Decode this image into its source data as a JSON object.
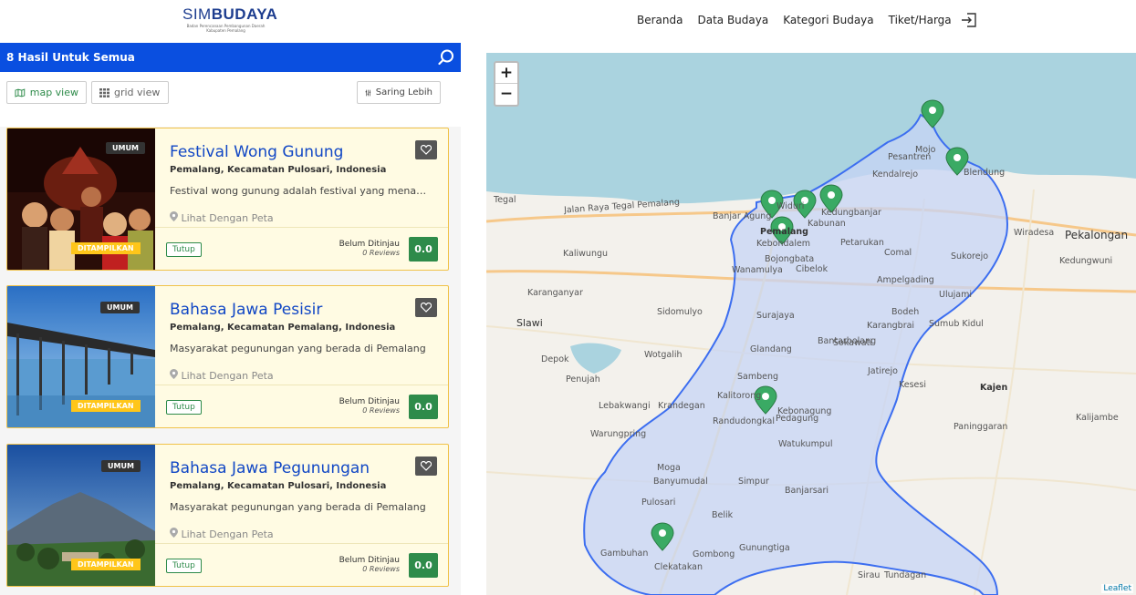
{
  "logo": {
    "main": "SIM",
    "main2": "BUDAYA",
    "sub": "Badan Perencanaan Pembangunan Daerah Kabupaten Pemalang"
  },
  "nav": [
    "Beranda",
    "Data Budaya",
    "Kategori Budaya",
    "Tiket/Harga"
  ],
  "results": {
    "title": "8 Hasil Untuk Semua"
  },
  "tools": {
    "map_view": "map view",
    "grid_view": "grid view",
    "filter": "Saring Lebih"
  },
  "cards": [
    {
      "badge": "UMUM",
      "status": "DITAMPILKAN",
      "title": "Festival Wong Gunung",
      "location": "Pemalang, Kecamatan Pulosari, Indonesia",
      "desc": "Festival wong gunung adalah festival yang menampilkan",
      "peta": "Lihat Dengan Peta",
      "tutup": "Tutup",
      "review_title": "Belum Ditinjau",
      "review_count": "0 Reviews",
      "score": "0.0"
    },
    {
      "badge": "UMUM",
      "status": "DITAMPILKAN",
      "title": "Bahasa Jawa Pesisir",
      "location": "Pemalang, Kecamatan Pemalang, Indonesia",
      "desc": "Masyarakat pegunungan yang berada di Pemalang",
      "peta": "Lihat Dengan Peta",
      "tutup": "Tutup",
      "review_title": "Belum Ditinjau",
      "review_count": "0 Reviews",
      "score": "0.0"
    },
    {
      "badge": "UMUM",
      "status": "DITAMPILKAN",
      "title": "Bahasa Jawa Pegunungan",
      "location": "Pemalang, Kecamatan Pulosari, Indonesia",
      "desc": "Masyarakat pegunungan yang berada di Pemalang",
      "peta": "Lihat Dengan Peta",
      "tutup": "Tutup",
      "review_title": "Belum Ditinjau",
      "review_count": "0 Reviews",
      "score": "0.0"
    }
  ],
  "map": {
    "zoom_in": "+",
    "zoom_out": "−",
    "attribution": "Leaflet",
    "labels": [
      "Tegal",
      "Jalan Raya Tegal Pemalang",
      "Banjar Agung",
      "Widuri",
      "Pemalang",
      "Kebondalem",
      "Bojongbata",
      "Mojo",
      "Pesantren",
      "Blendung",
      "Kendalrejo",
      "Kedungbanjar",
      "Kabunan",
      "Petarukan",
      "Comal",
      "Ampelgading",
      "Bodeh",
      "Sumub Kidul",
      "Kajen",
      "Wiradesa",
      "Pekalongan",
      "Randudongkal",
      "Belik",
      "Moga",
      "Pulosari",
      "Watukumpul",
      "Bantarbolang",
      "Ulujami",
      "Kedungwuni",
      "Karanganyar",
      "Slawi",
      "Kaliwungu",
      "Warungpring",
      "Surajaya",
      "Sokawati",
      "Jatirejo",
      "Karangbrai",
      "Banyumudal",
      "Gunungtiga",
      "Gombong",
      "Clekatakan",
      "Gambuhan",
      "Kebonagung",
      "Cibelok",
      "Sukorejo",
      "Sirau",
      "Tundagan",
      "Kesesi",
      "Paninggaran",
      "Kalijambe",
      "Wanamulya",
      "Sidomulyo",
      "Wotgalih",
      "Penujah",
      "Depok",
      "Lebakwangi",
      "Banyumudal",
      "Simpur",
      "Banjarsari",
      "Pedagung",
      "Sambeng",
      "Kalitorong",
      "Krandegan",
      "Glandang",
      "Surajaya"
    ]
  }
}
